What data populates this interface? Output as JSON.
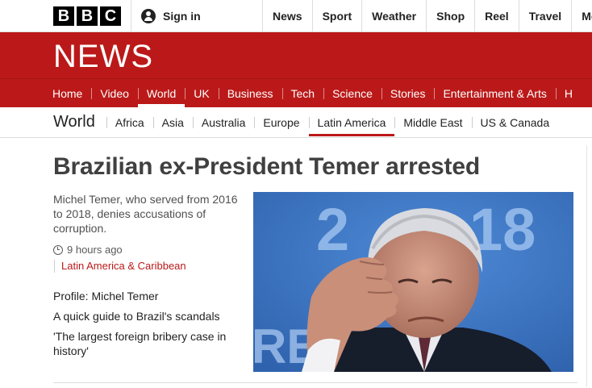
{
  "header": {
    "logo_letters": [
      "B",
      "B",
      "C"
    ],
    "signin_label": "Sign in",
    "nav": [
      "News",
      "Sport",
      "Weather",
      "Shop",
      "Reel",
      "Travel",
      "More"
    ]
  },
  "banner": {
    "wordmark": "NEWS"
  },
  "main_nav": {
    "items": [
      "Home",
      "Video",
      "World",
      "UK",
      "Business",
      "Tech",
      "Science",
      "Stories",
      "Entertainment & Arts",
      "H"
    ],
    "active": "World"
  },
  "sub_nav": {
    "title": "World",
    "items": [
      "Africa",
      "Asia",
      "Australia",
      "Europe",
      "Latin America",
      "Middle East",
      "US & Canada"
    ],
    "active": "Latin America"
  },
  "article": {
    "headline": "Brazilian ex-President Temer arrested",
    "summary": "Michel Temer, who served from 2016 to 2018, denies accusations of corruption.",
    "time": "9 hours ago",
    "section": "Latin America & Caribbean",
    "related": [
      "Profile: Michel Temer",
      "A quick guide to Brazil's scandals",
      "'The largest foreign bribery case in history'"
    ],
    "image_backdrop_text": [
      "2",
      "18",
      "RE"
    ]
  },
  "colors": {
    "bbc_red": "#bb1919",
    "photo_blue": "#3d78c9",
    "text_dark": "#222222"
  }
}
